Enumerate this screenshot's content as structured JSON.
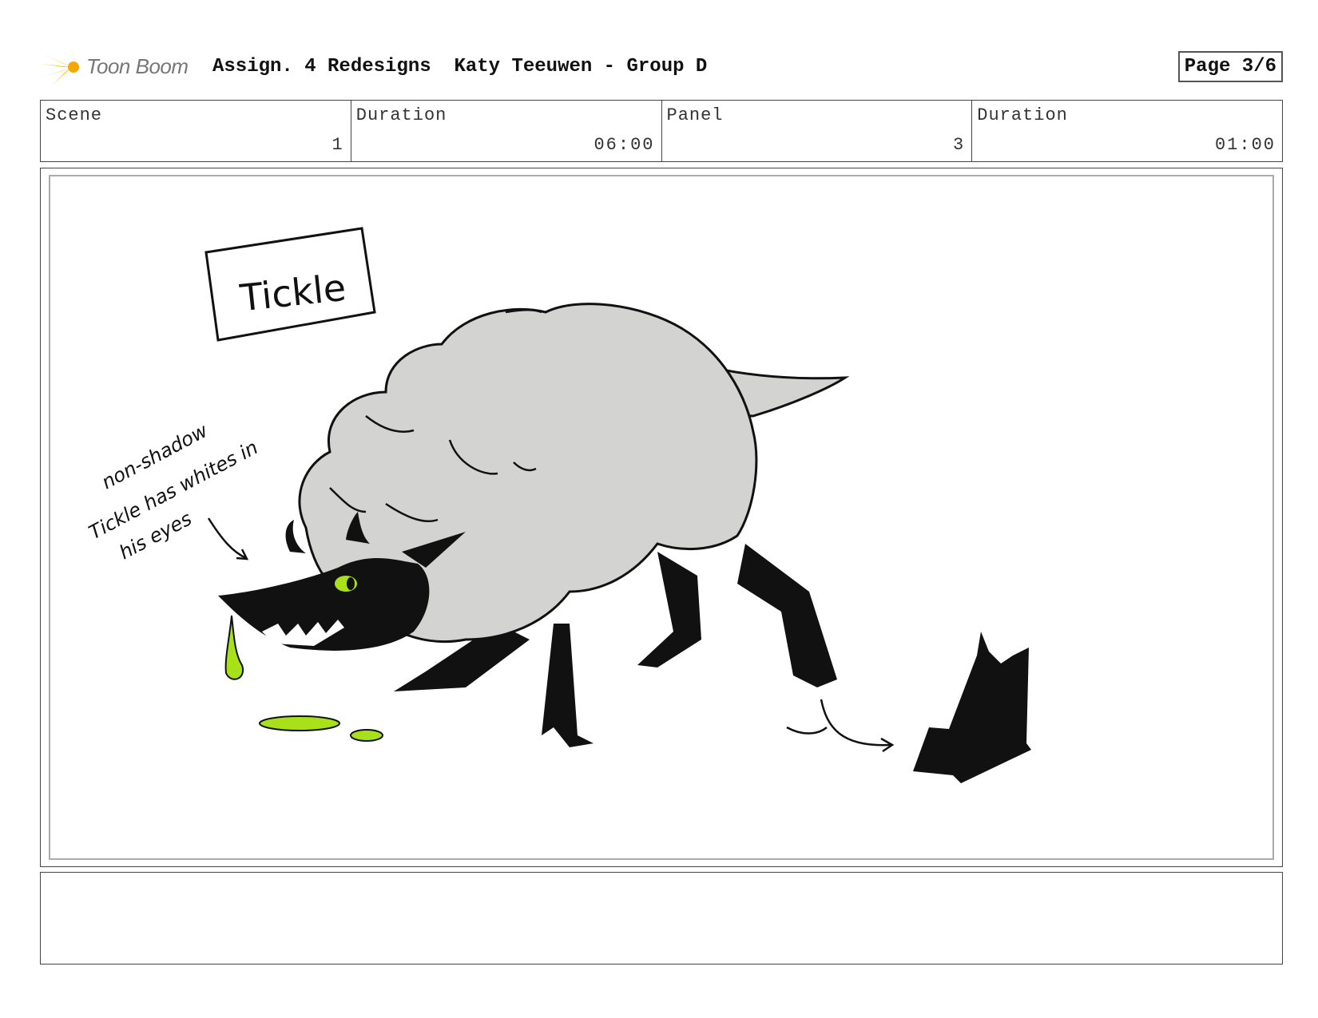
{
  "header": {
    "logo_text": "Toon Boom",
    "title": "Assign. 4 Redesigns  Katy Teeuwen - Group D",
    "page": "Page 3/6"
  },
  "info": {
    "scene_label": "Scene",
    "scene_value": "1",
    "scene_duration_label": "Duration",
    "scene_duration_value": "06:00",
    "panel_label": "Panel",
    "panel_value": "3",
    "panel_duration_label": "Duration",
    "panel_duration_value": "01:00"
  },
  "panel": {
    "sign_text": "Tickle",
    "note_line1": "non-shadow",
    "note_line2": "Tickle has whites in",
    "note_line3": "his eyes",
    "colors": {
      "fur": "#d3d3d1",
      "ink": "#111111",
      "slime": "#a8e01a"
    }
  },
  "notes": {
    "text": ""
  }
}
